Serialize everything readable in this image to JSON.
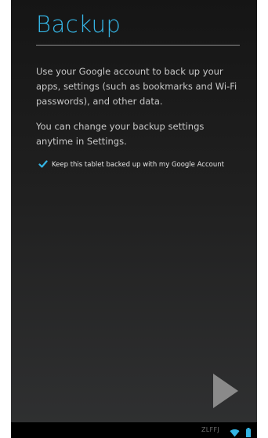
{
  "header": {
    "title": "Backup"
  },
  "content": {
    "paragraph_1": "Use your Google account to back up your apps, settings (such as bookmarks and Wi-Fi passwords), and other data.",
    "paragraph_2": "You can change your backup settings anytime in Settings.",
    "backup_checkbox": {
      "label": "Keep this tablet backed up with my Google Account",
      "checked": true
    }
  },
  "navigation": {
    "next_icon": "play-arrow-icon"
  },
  "status_bar": {
    "code": "ZLFFJ",
    "wifi_icon": "wifi-icon",
    "battery_icon": "battery-icon"
  },
  "colors": {
    "accent": "#35b5e5",
    "background": "#1c1c1c",
    "status_bar": "#000000"
  }
}
